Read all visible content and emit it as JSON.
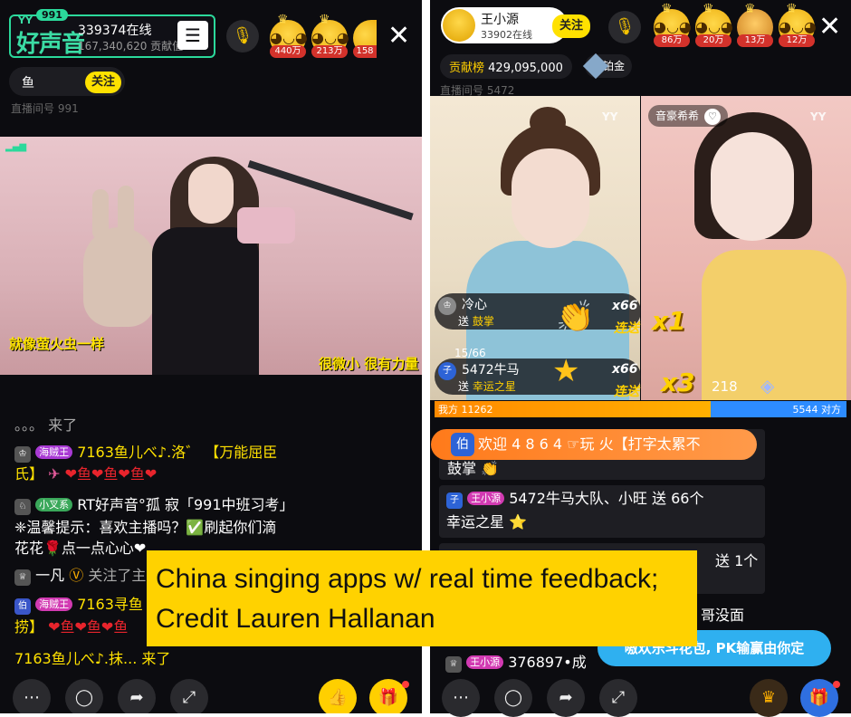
{
  "left": {
    "logo": {
      "yy": "YY",
      "badge": "991",
      "text": "好声音"
    },
    "online": "339374在线",
    "contribution": "167,340,620 贡献值",
    "menu_icon": "list-icon",
    "fans": [
      {
        "num": "440万"
      },
      {
        "num": "213万"
      },
      {
        "num": "158"
      }
    ],
    "anchor_name": "鱼",
    "follow_label": "关注",
    "room_number": "直播间号 991",
    "subtitle_left": "就像萤火虫一样",
    "subtitle_right": "很微小 很有力量",
    "chat": {
      "line0": "。。。 来了",
      "line1_badge": "海贼王",
      "line1_text": "7163鱼儿べ♪.洛゛ 【万能屈臣",
      "line1b_text": "氏】",
      "line1b_hearts": "❤鱼❤鱼❤鱼❤",
      "line2_badge": "小叉系",
      "line2_text": "RT好声音°孤 寂「991中班习考」",
      "line2b_text": "❈温馨提示：喜欢主播吗？✅刷起你们滴",
      "line2c_text": "花花🌹点一点心心❤",
      "line3_name": "一凡",
      "line3_text": "关注了主",
      "line4_badge": "海贼王",
      "line4_text": "7163寻鱼",
      "line4b_text": "捞】",
      "line4b_hearts": "❤鱼❤鱼❤鱼",
      "line5_text": "7163鱼儿べ♪.抹... 来了"
    }
  },
  "right": {
    "anchor": {
      "name": "王小源",
      "online": "33902在线"
    },
    "follow_label": "关注",
    "fans": [
      {
        "num": "86万"
      },
      {
        "num": "20万"
      },
      {
        "num": "13万"
      },
      {
        "num": "12万"
      }
    ],
    "contrib_label": "贡献榜",
    "contrib_value": "429,095,000",
    "tier": "铂金",
    "room_number": "直播间号 5472",
    "guest_name": "音豪希希",
    "gifts": [
      {
        "user": "冷心",
        "verb": "送",
        "gift": "鼓掌",
        "x": "x66",
        "combo": "连送",
        "mult": "x1"
      },
      {
        "user": "5472牛马",
        "verb": "送",
        "gift": "幸运之星",
        "x": "x66",
        "combo": "连送",
        "mult": "x3"
      }
    ],
    "counter": "15/66",
    "pk_score": "218",
    "pk_left": "我方 11262",
    "pk_right": "5544 对方",
    "pk_left_ratio": 0.67,
    "welcome": "欢迎 4 8 6 4 ☞玩 火【打字太累不",
    "chat": {
      "line1": "鼓掌 👏",
      "line2_badge": "王小源",
      "line2_text": "5472牛马大队、小旺 送 66个",
      "line2b": "幸运之星 ⭐",
      "line3": "送 1个",
      "line4": "哥没面",
      "line5_badge": "王小源",
      "line5_text": "376897•成"
    },
    "pk_banner": "嗷欢乐斗花包, PK输赢由你定"
  },
  "caption": {
    "line1": "China singing apps w/ real time feedback;",
    "line2": "Credit Lauren Hallanan"
  }
}
